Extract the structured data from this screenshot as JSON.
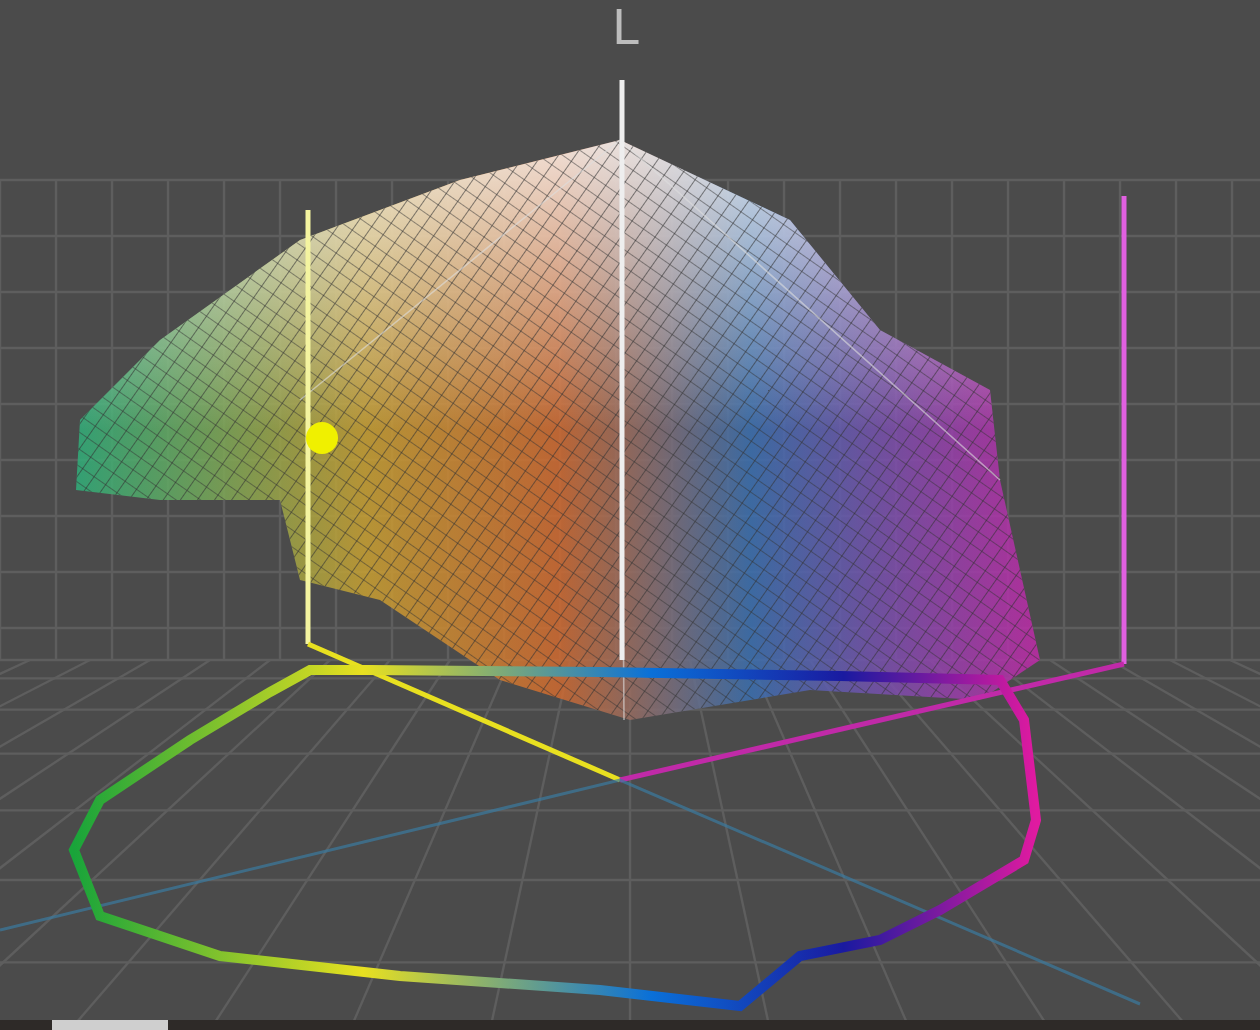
{
  "viewer": {
    "axis_label": "L"
  }
}
